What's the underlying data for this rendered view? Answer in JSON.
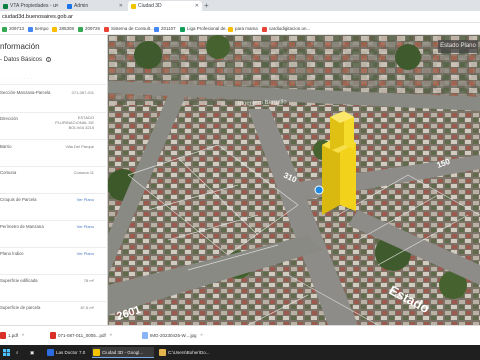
{
  "browser": {
    "tabs": [
      {
        "label": "VTA Propiedades - u",
        "fav_color": "#0b8043"
      },
      {
        "label": "Admin",
        "fav_color": "#1a73e8"
      },
      {
        "label": "Ciudad 3D",
        "fav_color": "#f2c300",
        "active": true
      }
    ],
    "new_tab": "+",
    "url": "ciudad3d.buenosaires.gob.ar",
    "bookmarks": [
      {
        "label": "209713",
        "fav_color": "#34a853"
      },
      {
        "label": "tiempo",
        "fav_color": "#4285f4"
      },
      {
        "label": "285308",
        "fav_color": "#fbbc05"
      },
      {
        "label": "209726",
        "fav_color": "#34a853"
      },
      {
        "label": "Sistema de Consult...",
        "fav_color": "#ea4335"
      },
      {
        "label": "201107",
        "fav_color": "#4285f4"
      },
      {
        "label": "Liga Profesional de...",
        "fav_color": "#0f9d58"
      },
      {
        "label": "para mama",
        "fav_color": "#fbbc05"
      },
      {
        "label": "cardiodigitacion.un...",
        "fav_color": "#ea4335"
      }
    ]
  },
  "panel": {
    "title": "nformación",
    "section_title": "- Datos Básicos",
    "faded_line": "· · · · · · · · · ·",
    "rows": [
      {
        "label": "Sección-Manzana-Parcela",
        "value": "071-087-011"
      },
      {
        "label": "Dirección",
        "value": "ESTADO\nPLURINACIONAL DE\nBOLIVIA 3215"
      },
      {
        "label": "Barrio",
        "value": "Villa Del Parque"
      },
      {
        "label": "Comuna",
        "value": "Comuna 11"
      },
      {
        "label": "Croquis de Parcela",
        "link": "Ver Plano"
      },
      {
        "label": "Perímetro de Manzana",
        "link": "Ver Plano"
      },
      {
        "label": "Plano Índice",
        "link": "Ver Plano"
      },
      {
        "label": "Superficie edificada",
        "value": "78 m²"
      },
      {
        "label": "Superficie de parcela",
        "value": "87,6 m²"
      }
    ]
  },
  "map": {
    "view_button": "Estado Plano",
    "street_labels": [
      "Estado",
      "2601",
      "150",
      "310"
    ]
  },
  "downloads": [
    {
      "label": "1.pdf"
    },
    {
      "label": "071-087-011_0005...pdf"
    },
    {
      "label": "IMG-20230425-W....jpg"
    }
  ],
  "taskbar": [
    {
      "label": "Las Doctor 7.0",
      "icon_color": "#2d6cdf"
    },
    {
      "label": "Ciudad 3D - Googl...",
      "icon_color": "#f2c300",
      "active": true
    },
    {
      "label": "C:\\Users\\Boher\\Do...",
      "icon_color": "#e2b44b"
    }
  ]
}
